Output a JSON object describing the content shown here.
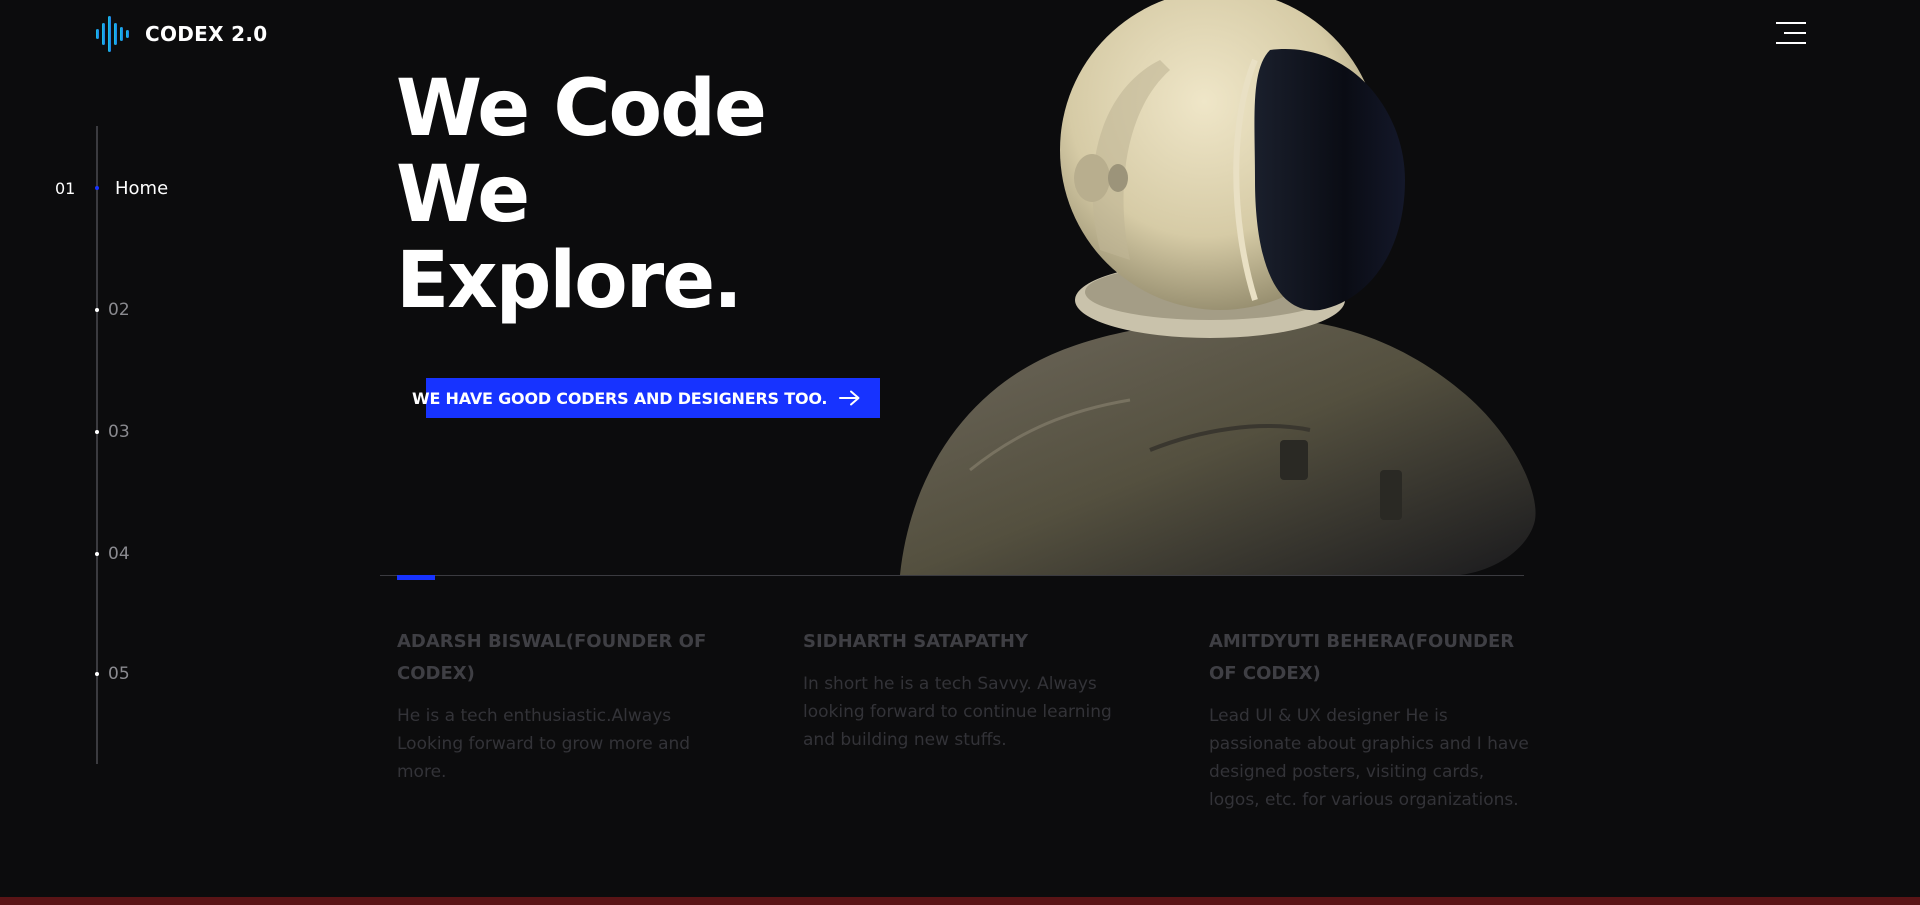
{
  "brand": {
    "name": "CODEX 2.0",
    "accent": "#1733ff"
  },
  "header": {
    "menu_icon": "hamburger-menu-icon"
  },
  "side_nav": {
    "items": [
      {
        "number": "01",
        "label": "Home",
        "active": true
      },
      {
        "number": "02"
      },
      {
        "number": "03"
      },
      {
        "number": "04"
      },
      {
        "number": "05"
      }
    ]
  },
  "hero": {
    "title_lines": [
      "We Code",
      "We",
      "Explore."
    ],
    "cta_label": "WE HAVE GOOD CODERS AND DESIGNERS TOO.",
    "cta_icon": "arrow-right-icon"
  },
  "team": [
    {
      "name": "ADARSH BISWAL(FOUNDER OF CODEX)",
      "bio": "He is a tech enthusiastic.Always Looking forward to grow more and more."
    },
    {
      "name": "SIDHARTH SATAPATHY",
      "bio": "In short he is a tech Savvy. Always looking forward to continue learning and building new stuffs."
    },
    {
      "name": "AMITDYUTI BEHERA(FOUNDER OF CODEX)",
      "bio": "Lead UI & UX designer He is passionate about graphics and I have designed posters, visiting cards, logos, etc. for various organizations."
    }
  ]
}
